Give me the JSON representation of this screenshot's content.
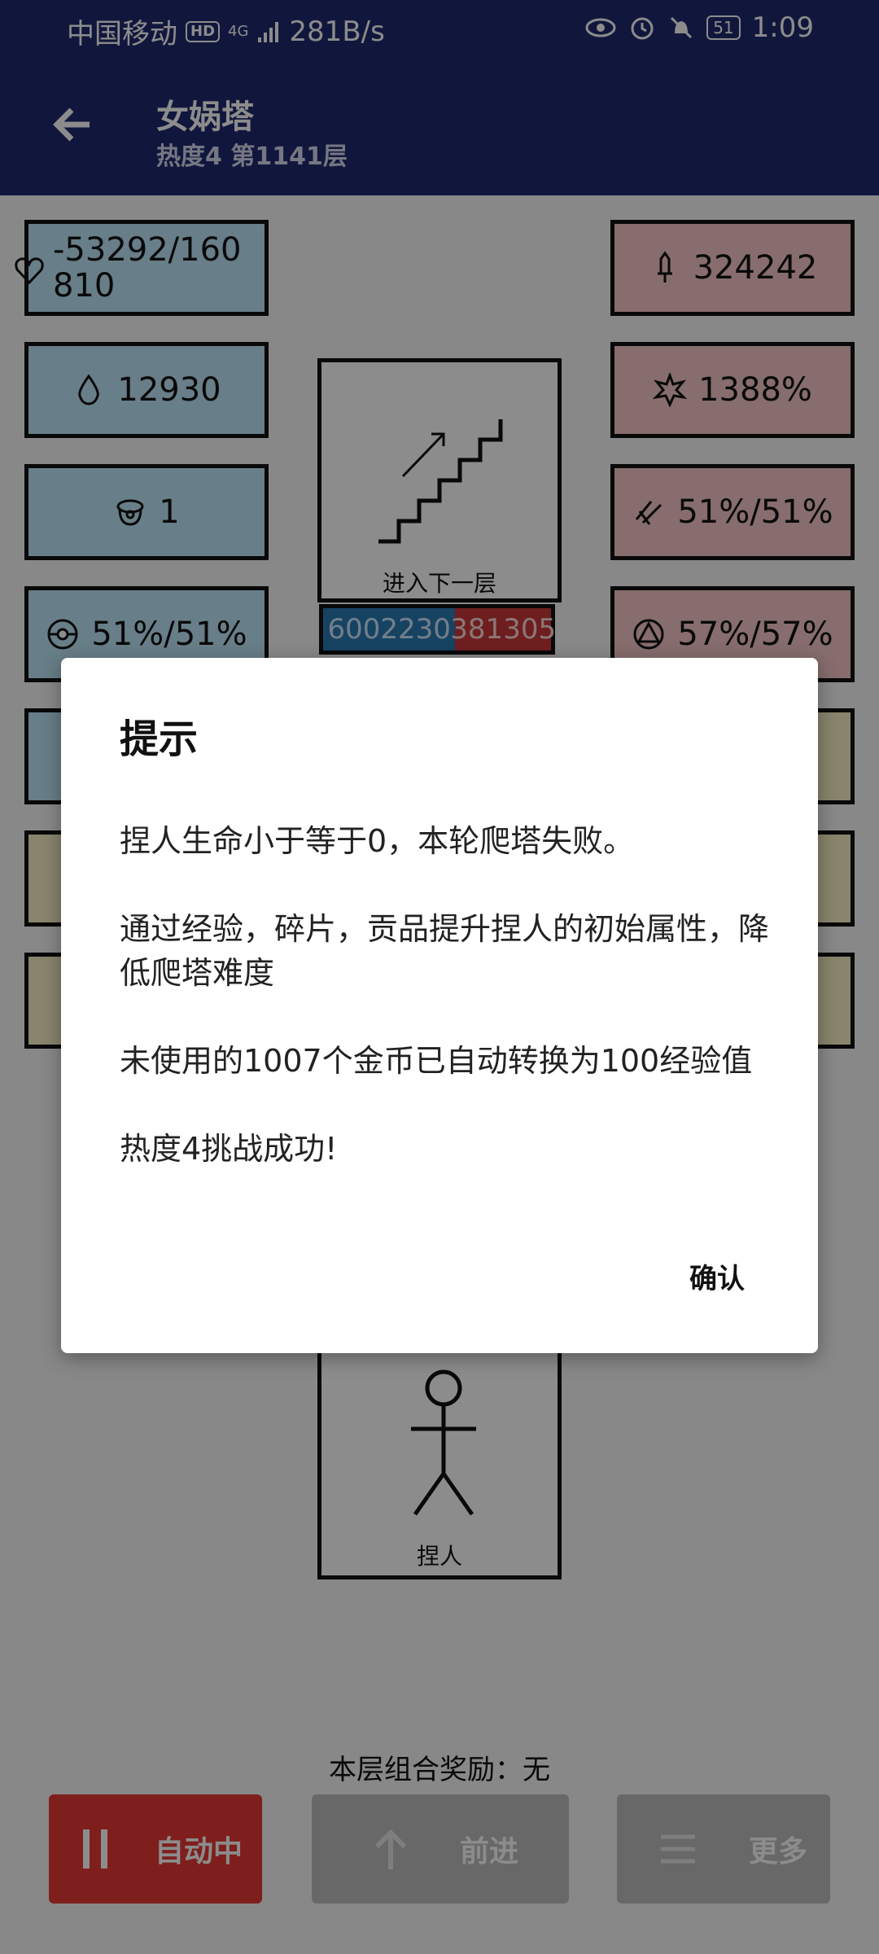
{
  "status": {
    "carrier": "中国移动",
    "hd_badge": "HD",
    "network": "4G",
    "speed": "281B/s",
    "battery": "51",
    "time": "1:09"
  },
  "header": {
    "title": "女娲塔",
    "subtitle": "热度4 第1141层"
  },
  "left_stats": [
    {
      "icon": "heart-icon",
      "value": "-53292/160810"
    },
    {
      "icon": "drop-icon",
      "value": "12930"
    },
    {
      "icon": "helmet-icon",
      "value": "1"
    },
    {
      "icon": "shield-icon",
      "value": "51%/51%"
    }
  ],
  "right_stats": [
    {
      "icon": "sword-icon",
      "value": "324242"
    },
    {
      "icon": "burst-icon",
      "value": "1388%"
    },
    {
      "icon": "slash-icon",
      "value": "51%/51%"
    },
    {
      "icon": "triangle-icon",
      "value": "57%/57%"
    }
  ],
  "next_floor": {
    "label": "进入下一层",
    "icon": "stairs-icon"
  },
  "enemy_hp": {
    "left": "6002230",
    "right": "381305"
  },
  "player": {
    "label": "捏人",
    "icon": "stickman-icon"
  },
  "combo_reward": "本层组合奖励：无",
  "buttons": {
    "auto": "自动中",
    "forward": "前进",
    "more": "更多"
  },
  "dialog": {
    "title": "提示",
    "message": "捏人生命小于等于0，本轮爬塔失败。\n\n通过经验，碎片，贡品提升捏人的初始属性，降低爬塔难度\n\n未使用的1007个金币已自动转换为100经验值\n\n热度4挑战成功!",
    "confirm": "确认"
  },
  "colors": {
    "primary": "#1f2a6e",
    "tile_blue": "#bde6f8",
    "tile_pink": "#f6c6c6",
    "tile_yellow": "#f9f0c7",
    "auto_red": "#e53935"
  }
}
